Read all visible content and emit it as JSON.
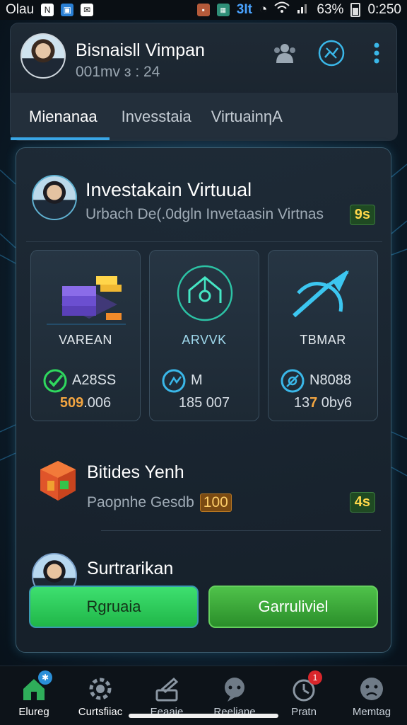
{
  "status_bar": {
    "carrier": "Olau",
    "battery_text": "63%",
    "time": "0:250",
    "center_text": "3It"
  },
  "header": {
    "user_name": "Bisnaisll Vimpan",
    "user_sub": "001mv ɜ : 24",
    "tabs": [
      {
        "label": "Mienanaa",
        "active": true
      },
      {
        "label": "Invesstaia",
        "active": false
      },
      {
        "label": "VirtuainηΑ",
        "active": false
      }
    ]
  },
  "profile": {
    "title": "Investakain Virtuual",
    "subtitle": "Urbach De(.0dgln Invetaasin Virtnas",
    "badge": "9s"
  },
  "tiles": [
    {
      "label": "VAREAN",
      "stat_code": "A28SS",
      "value_hl": "509",
      "value_rest": ".006",
      "icon": "check-circle-icon",
      "graphic": "server-stack-icon"
    },
    {
      "label": "ARVVK",
      "stat_code": "M",
      "value_hl": "",
      "value_rest": "185 007",
      "icon": "clock-chart-icon",
      "graphic": "neon-home-icon"
    },
    {
      "label": "TBMAR",
      "stat_code": "N8088",
      "value_hl": "7",
      "value_prefix": "13",
      "value_rest": " 0by6",
      "icon": "target-icon",
      "graphic": "growth-arrow-icon"
    }
  ],
  "bundle": {
    "title": "Bitides Yenh",
    "subtitle": "Paopnhe Gesdb",
    "inline_badge": "100",
    "right_badge": "4s"
  },
  "summary": {
    "title": "Surtrarikan"
  },
  "buttons": {
    "left": "Rgruaia",
    "right": "Garruliviel"
  },
  "bottom_nav": [
    {
      "label": "Elureg",
      "icon": "home-icon",
      "active": true,
      "badge": ""
    },
    {
      "label": "Curtsfiiac",
      "icon": "settings-icon",
      "active": false,
      "badge": ""
    },
    {
      "label": "Eeaaie",
      "icon": "edit-icon",
      "active": false,
      "badge": ""
    },
    {
      "label": "Reeliane",
      "icon": "chat-icon",
      "active": false,
      "badge": ""
    },
    {
      "label": "Pratn",
      "icon": "timer-icon",
      "active": false,
      "badge": "1"
    },
    {
      "label": "Memtag",
      "icon": "face-icon",
      "active": false,
      "badge": ""
    }
  ],
  "colors": {
    "accent": "#3aa7e6",
    "green": "#2fd85e",
    "orange": "#f2a541"
  }
}
